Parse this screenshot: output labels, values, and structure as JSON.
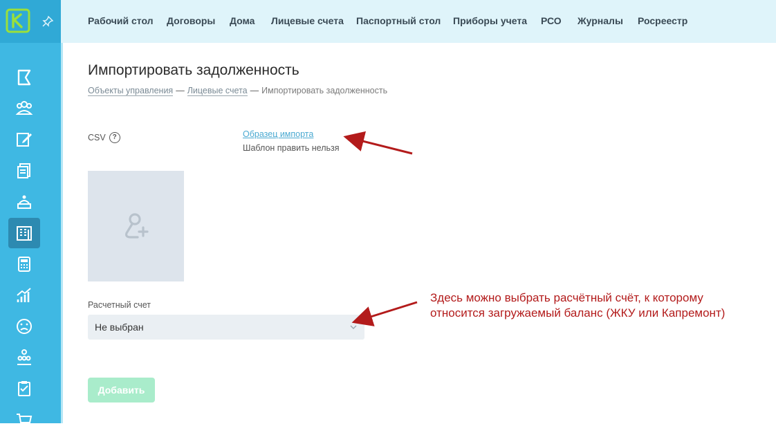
{
  "logo": {
    "letter": "K"
  },
  "nav": {
    "items": [
      "Рабочий стол",
      "Договоры",
      "Дома",
      "Лицевые счета",
      "Паспортный стол",
      "Приборы учета",
      "РСО",
      "Журналы",
      "Росреестр"
    ]
  },
  "sidebar": {
    "icons": [
      "flag-icon",
      "users-icon",
      "edit-icon",
      "documents-icon",
      "reception-icon",
      "building-icon",
      "calculator-icon",
      "chart-icon",
      "sad-face-icon",
      "team-icon",
      "checklist-icon",
      "cart-icon"
    ],
    "active_index": 5
  },
  "page": {
    "title": "Импортировать задолженность",
    "breadcrumb": {
      "link1": "Объекты управления",
      "link2": "Лицевые счета",
      "current": "Импортировать задолженность",
      "separator": "—"
    }
  },
  "form": {
    "csv_label": "CSV",
    "help_symbol": "?",
    "sample_link": "Образец импорта",
    "sample_note": "Шаблон править нельзя",
    "account_label": "Расчетный счет",
    "account_value": "Не выбран",
    "add_button": "Добавить"
  },
  "annotation": {
    "line1": "Здесь можно выбрать расчётный счёт, к которому",
    "line2": "относится загружаемый баланс (ЖКУ или Капремонт)",
    "color": "#b31b1b"
  },
  "colors": {
    "sidebar": "#3fb8e3",
    "topnav": "#dff4fa",
    "logo_accent": "#9be03a",
    "button": "#a9eccb"
  }
}
